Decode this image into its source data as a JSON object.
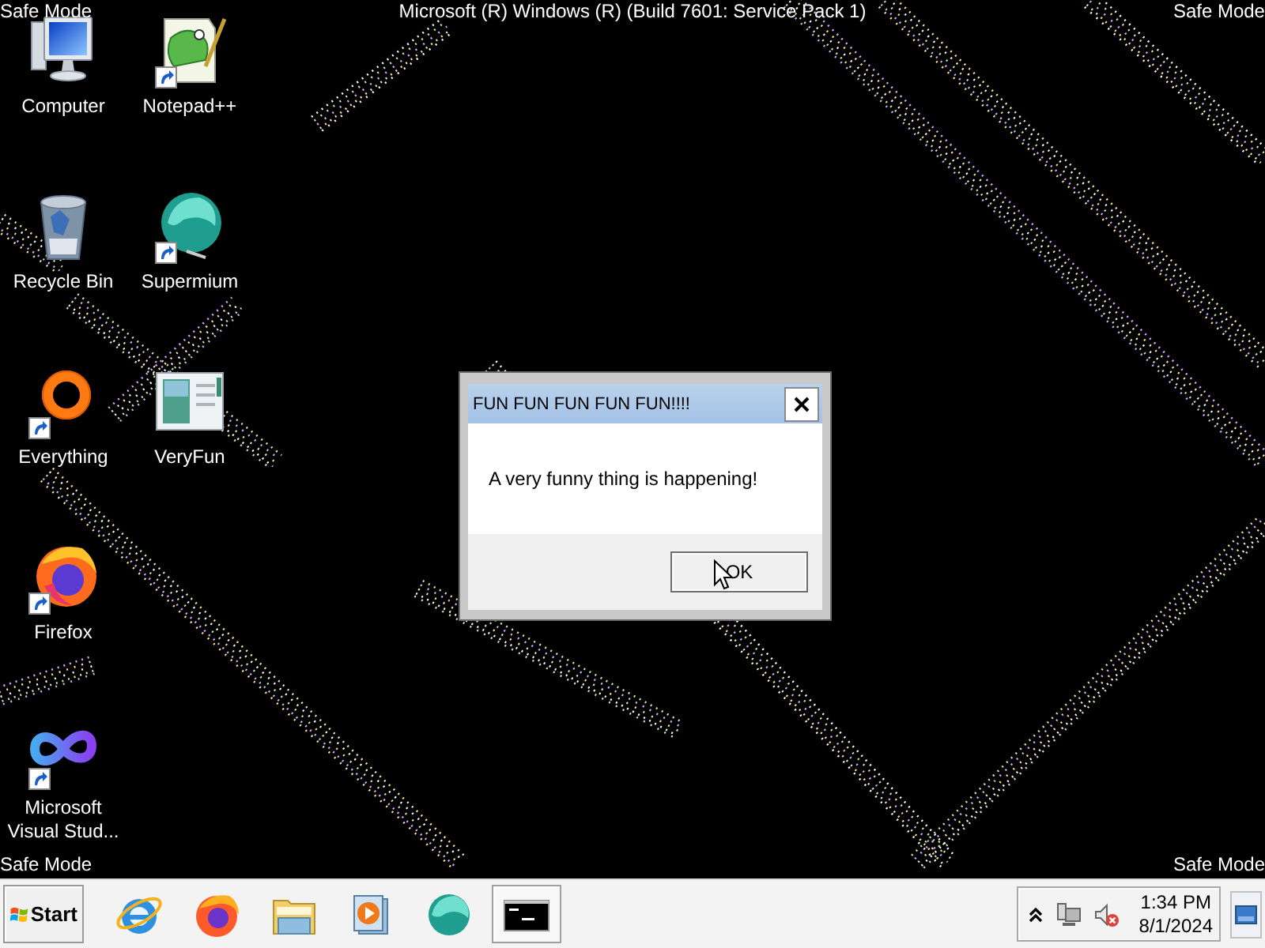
{
  "desktop": {
    "top_bar": {
      "left": "Safe Mode",
      "center": "Microsoft (R) Windows (R) (Build 7601: Service Pack 1)",
      "right": "Safe Mode"
    },
    "icons": [
      {
        "kind": "monitor",
        "label": "Computer",
        "shortcut": false
      },
      {
        "kind": "bin",
        "label": "Recycle Bin",
        "shortcut": false
      },
      {
        "kind": "ring",
        "label": "Everything",
        "shortcut": true
      },
      {
        "kind": "fox",
        "label": "Firefox",
        "shortcut": true
      },
      {
        "kind": "infinity",
        "label": "Microsoft Visual Stud...",
        "shortcut": true
      },
      {
        "kind": "notepad",
        "label": "Notepad++",
        "shortcut": true
      },
      {
        "kind": "sphere",
        "label": "Supermium",
        "shortcut": true
      },
      {
        "kind": "panel",
        "label": "VeryFun",
        "shortcut": false
      }
    ],
    "bottom_bar": {
      "left": "Safe Mode",
      "right": "Safe Mode"
    }
  },
  "dialog": {
    "title": "FUN FUN FUN FUN FUN!!!!",
    "message": "A very funny thing is happening!",
    "buttons": [
      "OK"
    ]
  },
  "taskbar": {
    "start": "Start",
    "pinned": [
      {
        "kind": "ie",
        "selected": false
      },
      {
        "kind": "fox",
        "selected": false
      },
      {
        "kind": "folder",
        "selected": false
      },
      {
        "kind": "media",
        "selected": false
      },
      {
        "kind": "sphere",
        "selected": false
      },
      {
        "kind": "console",
        "selected": true
      }
    ],
    "tray": {
      "volume_muted": true,
      "time": "1:34 PM",
      "date": "8/1/2024"
    }
  }
}
